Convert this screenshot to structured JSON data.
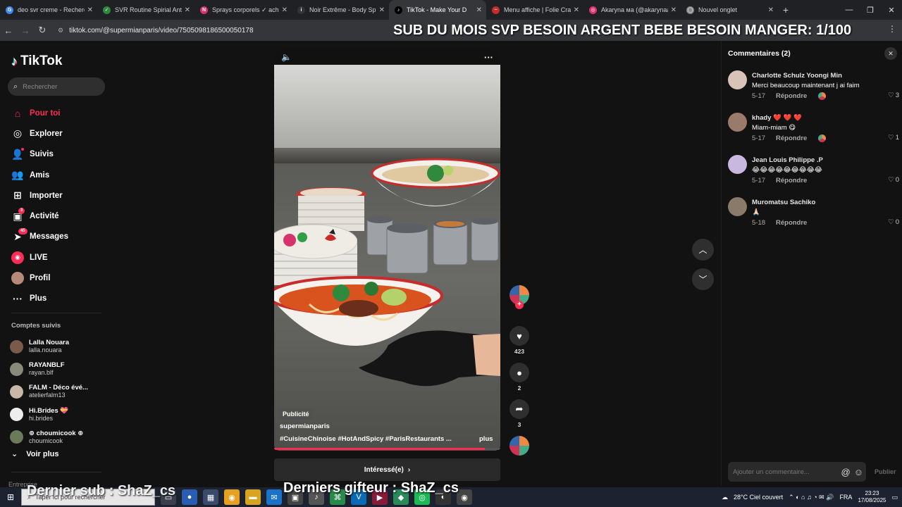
{
  "browser": {
    "tabs": [
      {
        "title": "deo svr creme - Recherche",
        "color": "#4285f4",
        "glyph": "G"
      },
      {
        "title": "SVR Routine Spirial Anti-T",
        "color": "#2b8a3e",
        "glyph": "✓"
      },
      {
        "title": "Sprays corporels ✓ ache",
        "color": "#d6336c",
        "glyph": "N"
      },
      {
        "title": "Noir Extrême - Body Spray",
        "color": "#333333",
        "glyph": "i"
      },
      {
        "title": "TikTok - Make Your D",
        "color": "#000000",
        "glyph": "♪",
        "active": true
      },
      {
        "title": "Menu affiche | Folie Crab",
        "color": "#c92a2a",
        "glyph": "~"
      },
      {
        "title": "Akaryna ма (@akarynaa)",
        "color": "#e1306c",
        "glyph": "◎"
      },
      {
        "title": "Nouvel onglet",
        "color": "#888888",
        "glyph": "◯"
      }
    ],
    "url": "tiktok.com/@supermianparis/video/7505098186500050178"
  },
  "stream_overlay": {
    "top": "SUB DU MOIS SVP BESOIN ARGENT BEBE BESOIN MANGER: 1/100",
    "bottom": "Derniers gifteur : ShaZ_cs",
    "bottom_left": "Dernier sub : ShaZ_cs"
  },
  "sidebar": {
    "logo": "TikTok",
    "search_placeholder": "Rechercher",
    "nav": [
      {
        "label": "Pour toi",
        "icon": "home-icon",
        "glyph": "⌂",
        "active": true
      },
      {
        "label": "Explorer",
        "icon": "compass-icon",
        "glyph": "◎"
      },
      {
        "label": "Suivis",
        "icon": "following-icon",
        "glyph": "👤",
        "dot": true
      },
      {
        "label": "Amis",
        "icon": "friends-icon",
        "glyph": "👥"
      },
      {
        "label": "Importer",
        "icon": "upload-icon",
        "glyph": "⊞"
      },
      {
        "label": "Activité",
        "icon": "activity-icon",
        "glyph": "▣",
        "badge": "3"
      },
      {
        "label": "Messages",
        "icon": "messages-icon",
        "glyph": "➤",
        "badge": "45"
      },
      {
        "label": "LIVE",
        "icon": "live-icon",
        "glyph": "◉"
      },
      {
        "label": "Profil",
        "icon": "profile-icon",
        "glyph": "●"
      },
      {
        "label": "Plus",
        "icon": "more-icon",
        "glyph": "···"
      }
    ],
    "following_title": "Comptes suivis",
    "following": [
      {
        "name": "Lalla Nouara",
        "handle": "lalla.nouara",
        "color": "#7a5a4a"
      },
      {
        "name": "RAYANBLF",
        "handle": "rayan.blf",
        "color": "#8a8a7a"
      },
      {
        "name": "FALM - Déco évé...",
        "handle": "atelierfalm13",
        "color": "#c9b8a8"
      },
      {
        "name": "Hi.Brides 💝",
        "handle": "hi.brides",
        "color": "#eeeeee"
      },
      {
        "name": "⊕ choumicook ⊕",
        "handle": "choumicook",
        "color": "#6a7a5a"
      }
    ],
    "voir_plus": "Voir plus",
    "entreprise": "Entreprise"
  },
  "video": {
    "ad_label": "Publicité",
    "username": "supermianparis",
    "hashtags": "#CuisineChinoise  #HotAndSpicy  #ParisRestaurants  ...",
    "more": "plus",
    "cta": "Intéressé(e)",
    "progress": 0.93
  },
  "actions": {
    "likes": "423",
    "comments": "2",
    "shares": "3"
  },
  "comments_panel": {
    "title": "Commentaires (2)",
    "reply_label": "Répondre",
    "items": [
      {
        "name": "Charlotte Schulz Yoongi Min",
        "text": "Merci beaucoup maintenant j ai faim",
        "date": "5-17",
        "likes": "3",
        "color": "#d9c3b8",
        "badge": true
      },
      {
        "name": "khady ❤️ ❤️ ❤️",
        "text": "Miam-miam 😋",
        "date": "5-17",
        "likes": "1",
        "color": "#9a7a6a",
        "badge": true
      },
      {
        "name": "Jean Louis Philippe .P",
        "text": "😂😂😂😂😂😂😂😂😂",
        "date": "5-17",
        "likes": "0",
        "color": "#c8b8e0",
        "badge": false
      },
      {
        "name": "Muromatsu Sachiko",
        "text": "🙏🏻",
        "date": "5-18",
        "likes": "0",
        "color": "#8a7a6a",
        "badge": false
      }
    ],
    "input_placeholder": "Ajouter un commentaire...",
    "post_label": "Publier"
  },
  "taskbar": {
    "search_placeholder": "Taper ici pour rechercher",
    "weather": "28°C  Ciel couvert",
    "lang": "FRA",
    "time": "23:23",
    "date": "17/08/2025"
  }
}
